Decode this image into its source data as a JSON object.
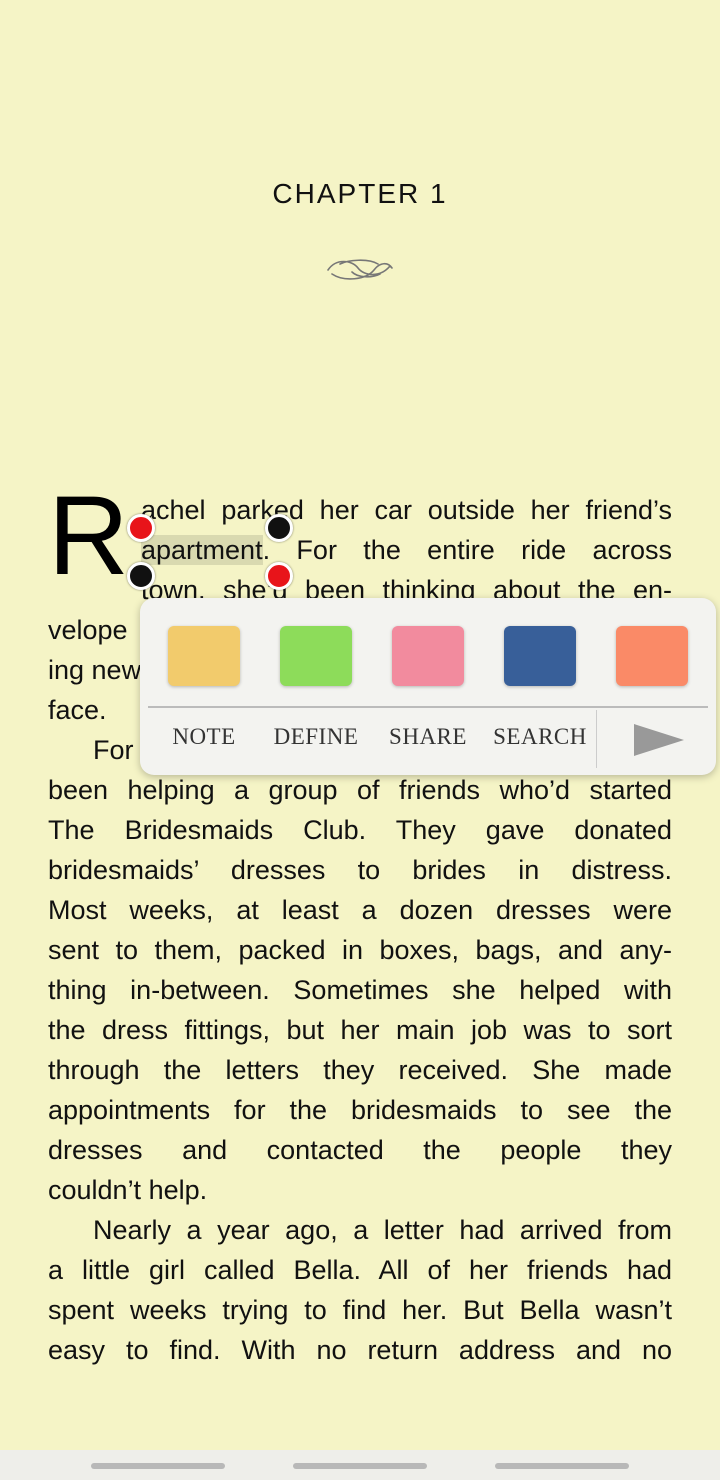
{
  "chapter": {
    "title": "CHAPTER 1"
  },
  "text": {
    "drop_cap": "R",
    "l1": "achel parked her car outside her friend’s",
    "l2_sel": "apartment",
    "l2_rest": ". For the entire ride across",
    "l3": "town, she’d been thinking about the en-",
    "l4a": "velope",
    "l5a": "ing new",
    "l6a": "face.",
    "l7a": "For",
    "l8": "been helping a group of friends who’d started",
    "l9": "The Bridesmaids Club. They gave donated",
    "l10": "bridesmaids’ dresses to brides in distress.",
    "l11": "Most weeks, at least a dozen dresses were",
    "l12": "sent to them, packed in boxes, bags, and any-",
    "l13": "thing in-between. Sometimes she helped with",
    "l14": "the dress fittings, but her main job was to sort",
    "l15": "through the letters they received. She made",
    "l16": "appointments for the bridesmaids to see the",
    "l17": "dresses and contacted the people they",
    "l18": "couldn’t help.",
    "l19": "Nearly a year ago, a letter had arrived from",
    "l20": "a little girl called Bella. All of her friends had",
    "l21": "spent weeks trying to find her. But Bella wasn’t",
    "l22": "easy to find. With no return address and no"
  },
  "popup": {
    "colors": [
      "#f2cb6c",
      "#8ddc5a",
      "#f28b9e",
      "#385f99",
      "#fa8a67"
    ],
    "actions": [
      "NOTE",
      "DEFINE",
      "SHARE",
      "SEARCH"
    ],
    "more_icon": "play-arrow-icon"
  },
  "icons": {
    "ornament": "flourish-ornament-icon"
  }
}
